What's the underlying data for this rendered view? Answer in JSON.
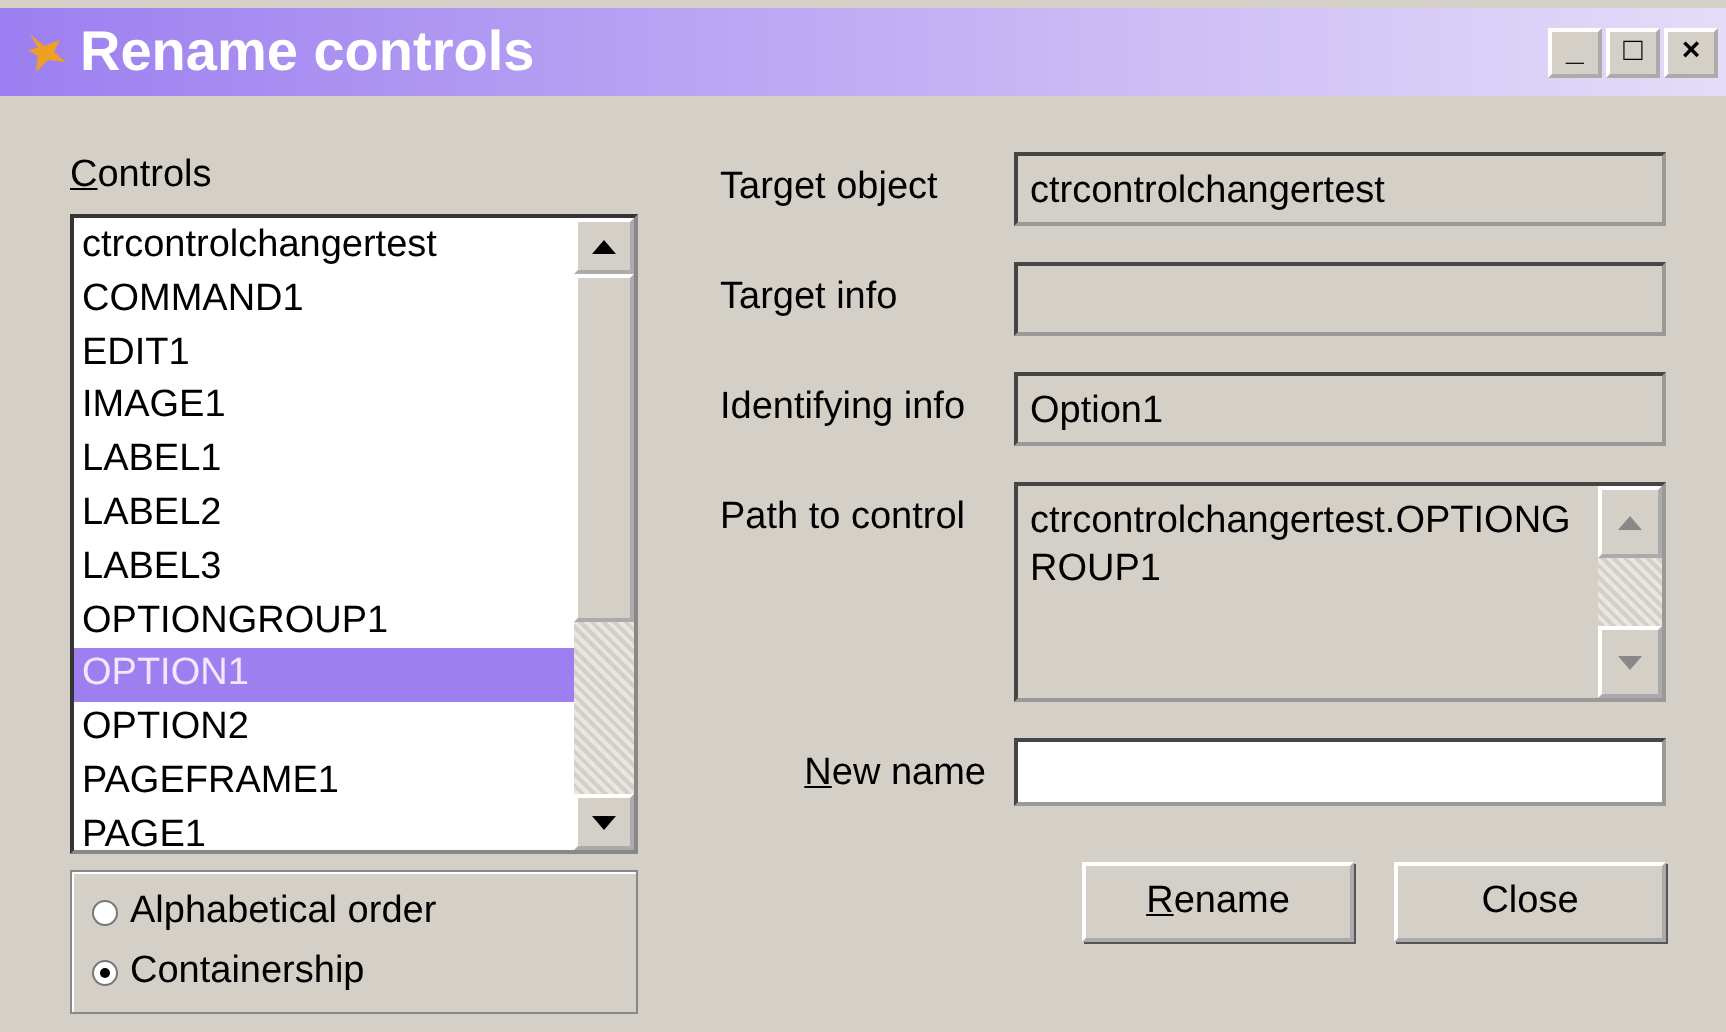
{
  "window": {
    "title": "Rename controls",
    "buttons": [
      "_",
      "□",
      "×"
    ]
  },
  "controls": {
    "label": "Controls",
    "underline_first": true,
    "items": [
      {
        "text": "ctrcontrolchangertest",
        "selected": false
      },
      {
        "text": "COMMAND1",
        "selected": false
      },
      {
        "text": "EDIT1",
        "selected": false
      },
      {
        "text": "IMAGE1",
        "selected": false
      },
      {
        "text": "LABEL1",
        "selected": false
      },
      {
        "text": "LABEL2",
        "selected": false
      },
      {
        "text": "LABEL3",
        "selected": false
      },
      {
        "text": "OPTIONGROUP1",
        "selected": false
      },
      {
        "text": "OPTION1",
        "selected": true
      },
      {
        "text": "OPTION2",
        "selected": false
      },
      {
        "text": "PAGEFRAME1",
        "selected": false
      },
      {
        "text": "PAGE1",
        "selected": false
      }
    ]
  },
  "order": [
    {
      "label": "Alphabetical order",
      "selected": false
    },
    {
      "label": "Containership",
      "selected": true
    }
  ],
  "fields": [
    {
      "label": "Target object",
      "value": "ctrcontrolchangertest",
      "kind": "readonly"
    },
    {
      "label": "Target info",
      "kind": "readonly"
    },
    {
      "label": "Identifying info",
      "value": "Option1",
      "kind": "readonly"
    },
    {
      "label": "Path to control",
      "value": "ctrcontrolchangertest.OPTIONGROUP1",
      "kind": "memo"
    },
    {
      "label": "New name",
      "kind": "input",
      "underline_first": true
    }
  ],
  "buttons": [
    {
      "label": "Rename",
      "underline_first": true
    },
    {
      "label": "Close",
      "underline_first": false
    }
  ]
}
